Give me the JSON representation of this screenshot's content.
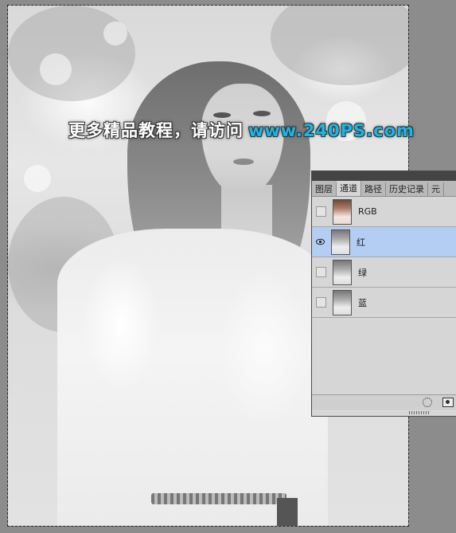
{
  "watermark": {
    "text": "更多精品教程，请访问",
    "url": "www.240PS.com"
  },
  "channels_panel": {
    "tabs": [
      {
        "label": "图层",
        "active": false
      },
      {
        "label": "通道",
        "active": true
      },
      {
        "label": "路径",
        "active": false
      },
      {
        "label": "历史记录",
        "active": false
      },
      {
        "label": "元",
        "active": false
      }
    ],
    "channels": [
      {
        "name": "RGB",
        "visible": false,
        "selected": false
      },
      {
        "name": "红",
        "visible": true,
        "selected": true
      },
      {
        "name": "绿",
        "visible": false,
        "selected": false
      },
      {
        "name": "蓝",
        "visible": false,
        "selected": false
      }
    ],
    "selected_color": "#b3cdf3",
    "bottom_icons": [
      "load-selection-icon",
      "save-selection-mask-icon"
    ]
  },
  "colors": {
    "workspace_bg": "#8c8c8c",
    "panel_bg": "#d6d6d6",
    "watermark_url": "#1ab7e6"
  }
}
